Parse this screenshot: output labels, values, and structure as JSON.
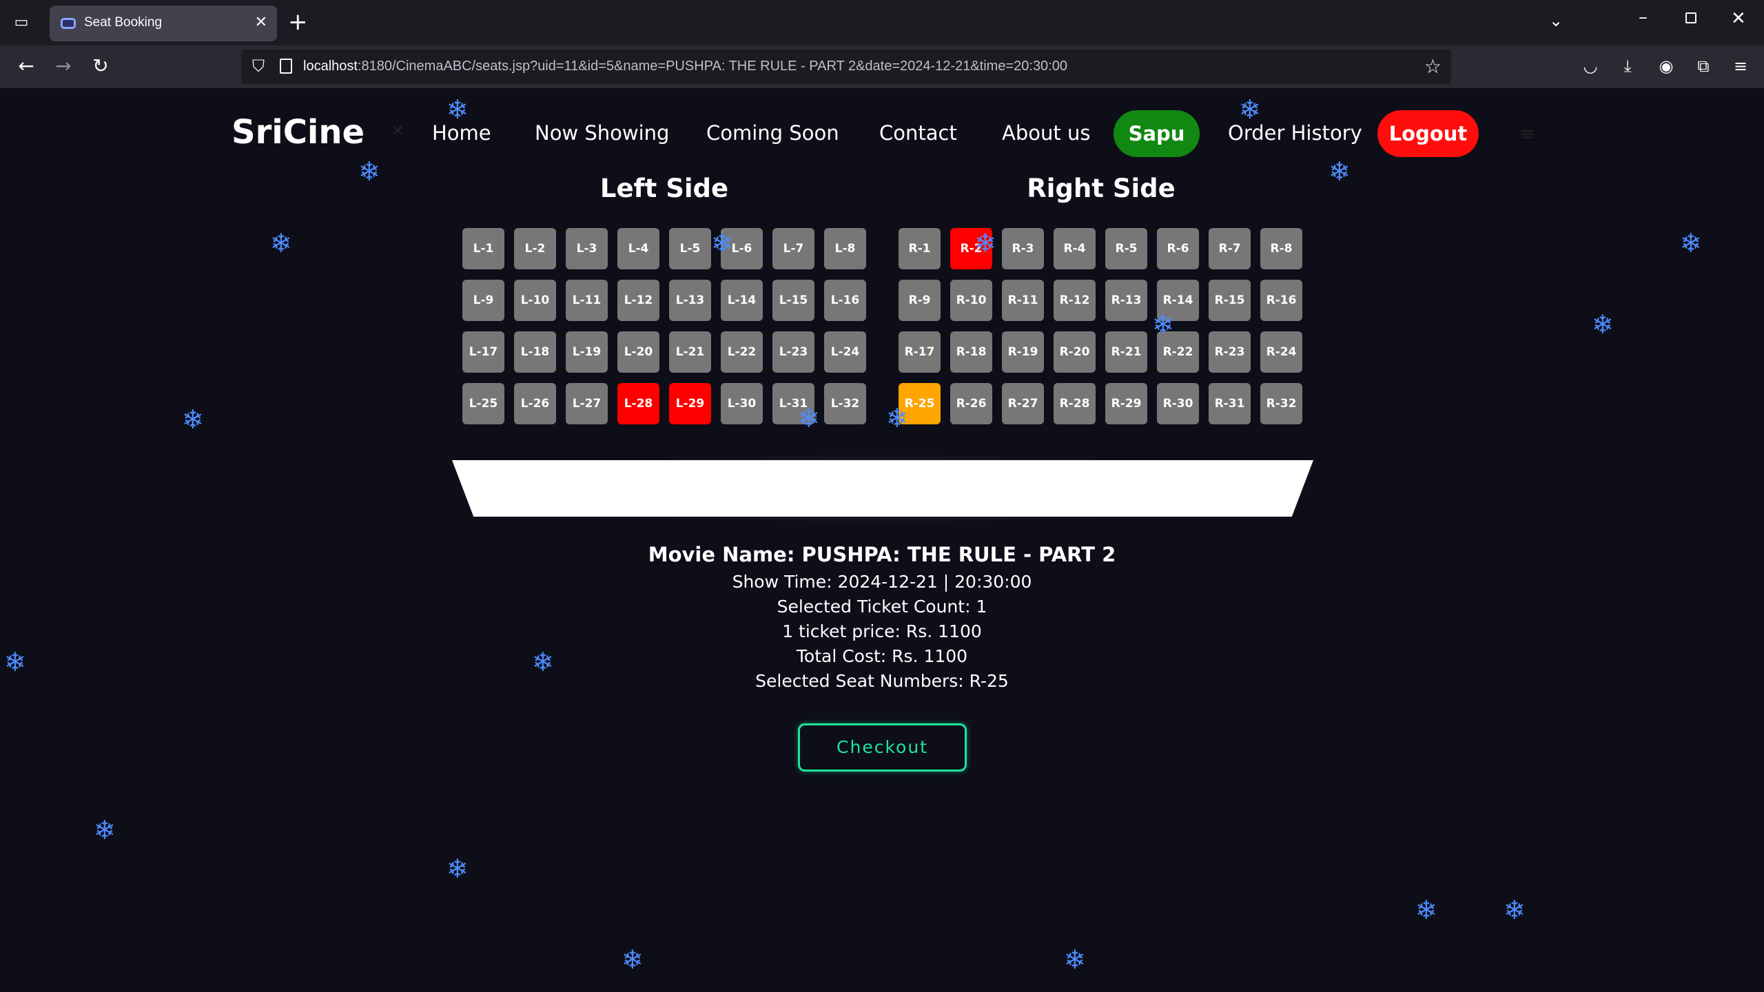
{
  "browser": {
    "tab_title": "Seat Booking",
    "url_host": "localhost",
    "url_rest": ":8180/CinemaABC/seats.jsp?uid=11&id=5&name=PUSHPA: THE RULE - PART 2&date=2024-12-21&time=20:30:00"
  },
  "nav": {
    "brand": "SriCine",
    "links": [
      "Home",
      "Now Showing",
      "Coming Soon",
      "Contact",
      "About us"
    ],
    "user": "Sapu",
    "order_history": "Order History",
    "logout": "Logout"
  },
  "left_side": {
    "title": "Left Side",
    "seats": [
      "L-1",
      "L-2",
      "L-3",
      "L-4",
      "L-5",
      "L-6",
      "L-7",
      "L-8",
      "L-9",
      "L-10",
      "L-11",
      "L-12",
      "L-13",
      "L-14",
      "L-15",
      "L-16",
      "L-17",
      "L-18",
      "L-19",
      "L-20",
      "L-21",
      "L-22",
      "L-23",
      "L-24",
      "L-25",
      "L-26",
      "L-27",
      "L-28",
      "L-29",
      "L-30",
      "L-31",
      "L-32"
    ],
    "booked": [
      "L-28",
      "L-29"
    ],
    "selected": []
  },
  "right_side": {
    "title": "Right Side",
    "seats": [
      "R-1",
      "R-2",
      "R-3",
      "R-4",
      "R-5",
      "R-6",
      "R-7",
      "R-8",
      "R-9",
      "R-10",
      "R-11",
      "R-12",
      "R-13",
      "R-14",
      "R-15",
      "R-16",
      "R-17",
      "R-18",
      "R-19",
      "R-20",
      "R-21",
      "R-22",
      "R-23",
      "R-24",
      "R-25",
      "R-26",
      "R-27",
      "R-28",
      "R-29",
      "R-30",
      "R-31",
      "R-32"
    ],
    "booked": [
      "R-2"
    ],
    "selected": [
      "R-25"
    ]
  },
  "summary": {
    "movie": "Movie Name: PUSHPA: THE RULE - PART 2",
    "show_time": "Show Time: 2024-12-21 | 20:30:00",
    "ticket_count": "Selected Ticket Count: 1",
    "ticket_price": "1 ticket price: Rs. 1100",
    "total_cost": "Total Cost: Rs. 1100",
    "seat_numbers": "Selected Seat Numbers: R-25"
  },
  "checkout_label": "Checkout",
  "colors": {
    "background": "#0d0e18",
    "seat_available": "#777777",
    "seat_booked": "#ff0000",
    "seat_selected": "#ffa500",
    "user_button": "#118811",
    "logout_button": "#ff0d0d",
    "checkout_accent": "#1ee49c",
    "snowflake": "#4d8cff"
  },
  "icons": {
    "snowflake": "❄"
  }
}
